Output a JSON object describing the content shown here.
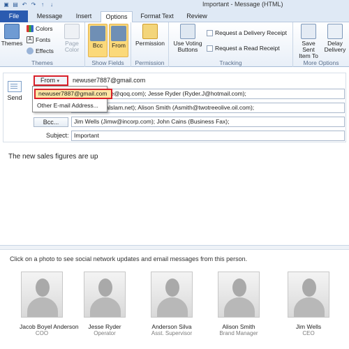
{
  "window": {
    "title": "Important - Message (HTML)"
  },
  "tabs": [
    "File",
    "Message",
    "Insert",
    "Options",
    "Format Text",
    "Review"
  ],
  "ribbon": {
    "themes_group": {
      "themes": "Themes",
      "colors": "Colors",
      "fonts": "Fonts",
      "effects": "Effects",
      "page_color": "Page Color",
      "label": "Themes"
    },
    "show_fields": {
      "bcc": "Bcc",
      "from": "From",
      "label": "Show Fields"
    },
    "permission": {
      "button": "Permission",
      "label": "Permission"
    },
    "tracking": {
      "use_voting": "Use Voting Buttons",
      "delivery_receipt": "Request a Delivery Receipt",
      "read_receipt": "Request a Read Receipt",
      "label": "Tracking"
    },
    "more_options": {
      "save_sent": "Save Sent Item To",
      "delay": "Delay Delivery",
      "label": "More Options"
    }
  },
  "header": {
    "send": "Send",
    "from_label": "From",
    "from_address": "newuser7887@gmail.com",
    "to_value": "nderson (Boyle@qoq.com); Jesse Ryder (Ryder.J@hotmail.com);",
    "cc_value": "(Silva@digitalslam.net); Alison Smith (Asmith@twotreeolive.oil.com);",
    "bcc_label": "Bcc...",
    "bcc_value": "Jim Wells (Jimw@incorp.com); John Cains (Business Fax);",
    "subject_label": "Subject:",
    "subject_value": "Important"
  },
  "from_dropdown": {
    "item_selected": "newuser7887@gmail.com",
    "item_other": "Other E-mail Address..."
  },
  "body": {
    "text": "The new sales figures are up"
  },
  "people_pane": {
    "info": "Click on a photo to see social network updates and email messages from this person.",
    "people": [
      {
        "name": "Jacob Boyel Anderson",
        "title": "COO"
      },
      {
        "name": "Jesse Ryder",
        "title": "Operator"
      },
      {
        "name": "Anderson Silva",
        "title": "Asst. Supervisor"
      },
      {
        "name": "Alison Smith",
        "title": "Brand Manager"
      },
      {
        "name": "Jim Wells",
        "title": "CEO"
      }
    ]
  }
}
